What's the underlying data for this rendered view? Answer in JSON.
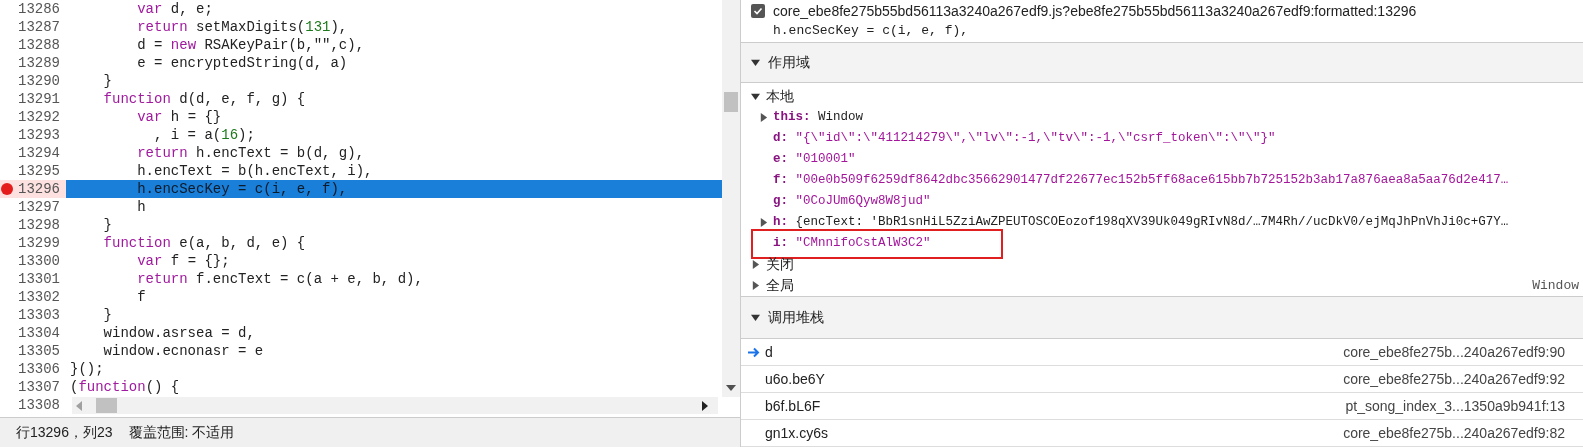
{
  "editor": {
    "lines": [
      {
        "number": "13286",
        "breakpoint": false,
        "selected": false,
        "tokens": [
          {
            "kind": "keyword",
            "text": "        var"
          },
          {
            "kind": "plain",
            "text": " d, e;"
          }
        ]
      },
      {
        "number": "13287",
        "breakpoint": false,
        "selected": false,
        "tokens": [
          {
            "kind": "keyword",
            "text": "        return"
          },
          {
            "kind": "plain",
            "text": " setMaxDigits("
          },
          {
            "kind": "number",
            "text": "131"
          },
          {
            "kind": "plain",
            "text": "),"
          }
        ]
      },
      {
        "number": "13288",
        "breakpoint": false,
        "selected": false,
        "tokens": [
          {
            "kind": "plain",
            "text": "        d = "
          },
          {
            "kind": "keyword",
            "text": "new"
          },
          {
            "kind": "plain",
            "text": " RSAKeyPair(b,\"\",c),"
          }
        ]
      },
      {
        "number": "13289",
        "breakpoint": false,
        "selected": false,
        "tokens": [
          {
            "kind": "plain",
            "text": "        e = encryptedString(d, a)"
          }
        ]
      },
      {
        "number": "13290",
        "breakpoint": false,
        "selected": false,
        "tokens": [
          {
            "kind": "plain",
            "text": "    }"
          }
        ]
      },
      {
        "number": "13291",
        "breakpoint": false,
        "selected": false,
        "tokens": [
          {
            "kind": "keyword",
            "text": "    function"
          },
          {
            "kind": "plain",
            "text": " d(d, e, f, g) {"
          }
        ]
      },
      {
        "number": "13292",
        "breakpoint": false,
        "selected": false,
        "tokens": [
          {
            "kind": "keyword",
            "text": "        var"
          },
          {
            "kind": "plain",
            "text": " h = {}"
          }
        ]
      },
      {
        "number": "13293",
        "breakpoint": false,
        "selected": false,
        "tokens": [
          {
            "kind": "plain",
            "text": "          , i = a("
          },
          {
            "kind": "number",
            "text": "16"
          },
          {
            "kind": "plain",
            "text": ");"
          }
        ]
      },
      {
        "number": "13294",
        "breakpoint": false,
        "selected": false,
        "tokens": [
          {
            "kind": "keyword",
            "text": "        return"
          },
          {
            "kind": "plain",
            "text": " h.encText = b(d, g),"
          }
        ]
      },
      {
        "number": "13295",
        "breakpoint": false,
        "selected": false,
        "tokens": [
          {
            "kind": "plain",
            "text": "        h.encText = b(h.encText, i),"
          }
        ]
      },
      {
        "number": "13296",
        "breakpoint": true,
        "selected": true,
        "tokens": [
          {
            "kind": "plain",
            "text": "        h.encSecKey = c(i, e, f),"
          }
        ]
      },
      {
        "number": "13297",
        "breakpoint": false,
        "selected": false,
        "tokens": [
          {
            "kind": "plain",
            "text": "        h"
          }
        ]
      },
      {
        "number": "13298",
        "breakpoint": false,
        "selected": false,
        "tokens": [
          {
            "kind": "plain",
            "text": "    }"
          }
        ]
      },
      {
        "number": "13299",
        "breakpoint": false,
        "selected": false,
        "tokens": [
          {
            "kind": "keyword",
            "text": "    function"
          },
          {
            "kind": "plain",
            "text": " e(a, b, d, e) {"
          }
        ]
      },
      {
        "number": "13300",
        "breakpoint": false,
        "selected": false,
        "tokens": [
          {
            "kind": "keyword",
            "text": "        var"
          },
          {
            "kind": "plain",
            "text": " f = {};"
          }
        ]
      },
      {
        "number": "13301",
        "breakpoint": false,
        "selected": false,
        "tokens": [
          {
            "kind": "keyword",
            "text": "        return"
          },
          {
            "kind": "plain",
            "text": " f.encText = c(a + e, b, d),"
          }
        ]
      },
      {
        "number": "13302",
        "breakpoint": false,
        "selected": false,
        "tokens": [
          {
            "kind": "plain",
            "text": "        f"
          }
        ]
      },
      {
        "number": "13303",
        "breakpoint": false,
        "selected": false,
        "tokens": [
          {
            "kind": "plain",
            "text": "    }"
          }
        ]
      },
      {
        "number": "13304",
        "breakpoint": false,
        "selected": false,
        "tokens": [
          {
            "kind": "plain",
            "text": "    window.asrsea = d,"
          }
        ]
      },
      {
        "number": "13305",
        "breakpoint": false,
        "selected": false,
        "tokens": [
          {
            "kind": "plain",
            "text": "    window.ecnonasr = e"
          }
        ]
      },
      {
        "number": "13306",
        "breakpoint": false,
        "selected": false,
        "tokens": [
          {
            "kind": "plain",
            "text": "}();"
          }
        ]
      },
      {
        "number": "13307",
        "breakpoint": false,
        "selected": false,
        "tokens": [
          {
            "kind": "plain",
            "text": "("
          },
          {
            "kind": "keyword",
            "text": "function"
          },
          {
            "kind": "plain",
            "text": "() {"
          }
        ]
      },
      {
        "number": "13308",
        "breakpoint": false,
        "selected": false
      }
    ]
  },
  "status_bar": {
    "position": "行13296，列23",
    "coverage": "覆盖范围: 不适用"
  },
  "breakpoint": {
    "checked": true,
    "location": "core_ebe8fe275b55bd56113a3240a267edf9.js?ebe8fe275b55bd56113a3240a267edf9:formatted:13296",
    "code": "h.encSecKey = c(i, e, f),"
  },
  "scope": {
    "title": "作用域",
    "expanded": true,
    "groups": [
      {
        "label": "本地",
        "expanded": true,
        "items": [
          {
            "kind": "object",
            "name": "this:",
            "value": "Window",
            "highlighted": false
          },
          {
            "kind": "string",
            "name": "d:",
            "value": "\"{\\\"id\\\":\\\"411214279\\\",\\\"lv\\\":-1,\\\"tv\\\":-1,\\\"csrf_token\\\":\\\"\\\"}\"",
            "highlighted": false
          },
          {
            "kind": "string",
            "name": "e:",
            "value": "\"010001\"",
            "highlighted": false
          },
          {
            "kind": "string",
            "name": "f:",
            "value": "\"00e0b509f6259df8642dbc35662901477df22677ec152b5ff68ace615bb7b725152b3ab17a876aea8a5aa76d2e417…",
            "highlighted": false
          },
          {
            "kind": "string",
            "name": "g:",
            "value": "\"0CoJUm6Qyw8W8jud\"",
            "highlighted": false
          },
          {
            "kind": "object",
            "name": "h:",
            "value": "{encText: 'BbR1snHiL5ZziAwZPEUTOSCOEozof198qXV39Uk049gRIvN8d/…7M4Rh//ucDkV0/ejMqJhPnVhJi0c+G7Y…",
            "highlighted": false
          },
          {
            "kind": "string",
            "name": "i:",
            "value": "\"CMnnifoCstAlW3C2\"",
            "highlighted": true
          }
        ]
      },
      {
        "label": "关闭",
        "expanded": false
      },
      {
        "label": "全局",
        "expanded": false,
        "value": "Window"
      }
    ]
  },
  "call_stack": {
    "title": "调用堆栈",
    "expanded": true,
    "frames": [
      {
        "name": "d",
        "location": "core_ebe8fe275b...240a267edf9:90",
        "current": true
      },
      {
        "name": "u6o.be6Y",
        "location": "core_ebe8fe275b...240a267edf9:92",
        "current": false
      },
      {
        "name": "b6f.bL6F",
        "location": "pt_song_index_3...1350a9b941f:13",
        "current": false
      },
      {
        "name": "gn1x.cy6s",
        "location": "core_ebe8fe275b...240a267edf9:82",
        "current": false
      }
    ]
  }
}
